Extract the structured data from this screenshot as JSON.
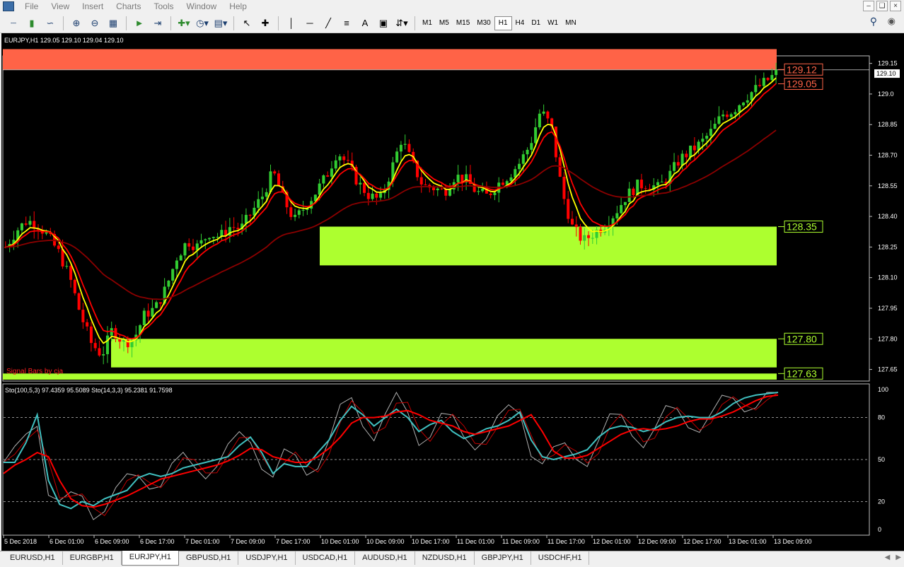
{
  "menu": [
    "File",
    "View",
    "Insert",
    "Charts",
    "Tools",
    "Window",
    "Help"
  ],
  "toolbar": {
    "icons": [
      "bar-chart-icon",
      "candlestick-icon",
      "line-chart-icon",
      "zoom-in-icon",
      "zoom-out-icon",
      "tile-windows-icon",
      "autoscroll-icon",
      "chart-shift-icon",
      "indicators-icon",
      "periods-icon",
      "templates-icon",
      "cursor-icon",
      "crosshair-icon",
      "vertical-line-icon",
      "horizontal-line-icon",
      "trendline-icon",
      "fibonacci-icon",
      "text-icon",
      "text-label-icon",
      "arrows-icon"
    ],
    "text_tool": "A",
    "timeframes": [
      "M1",
      "M5",
      "M15",
      "M30",
      "H1",
      "H4",
      "D1",
      "W1",
      "MN"
    ],
    "active_timeframe": "H1"
  },
  "chart": {
    "header": "EURJPY,H1  129.05 129.10 129.04 129.10",
    "signal_label": "Signal Bars by cja",
    "colors": {
      "bull": "#32cd32",
      "bear": "#ff0000",
      "zone": "#adff2f",
      "banner": "#ff6347",
      "ema_fast": "#ffff00",
      "ema_mid": "#ff0000",
      "ema_slow": "#8b0000"
    }
  },
  "price_axis": {
    "ticks": [
      "129.15",
      "129.0",
      "128.85",
      "128.70",
      "128.55",
      "128.40",
      "128.25",
      "128.10",
      "127.95",
      "127.80",
      "127.65"
    ],
    "current_price": "129.10"
  },
  "levels": [
    {
      "label": "129.12",
      "price": 129.12,
      "color": "#ff6347"
    },
    {
      "label": "129.05",
      "price": 129.05,
      "color": "#ff6347"
    },
    {
      "label": "128.35",
      "price": 128.35,
      "color": "#adff2f"
    },
    {
      "label": "127.80",
      "price": 127.8,
      "color": "#adff2f"
    },
    {
      "label": "127.63",
      "price": 127.63,
      "color": "#adff2f"
    }
  ],
  "zones": [
    {
      "top": 129.22,
      "bottom": 129.12,
      "color": "#ff6347"
    },
    {
      "top": 128.35,
      "bottom": 128.16,
      "color": "#adff2f"
    },
    {
      "top": 127.8,
      "bottom": 127.66,
      "color": "#adff2f"
    },
    {
      "top": 127.63,
      "bottom": 127.6,
      "color": "#adff2f"
    }
  ],
  "indicator": {
    "label": "Sto(100,5,3) 97.4359 95.5089  Sto(14,3,3) 95.2381 91.7598",
    "ticks": [
      "100",
      "80",
      "50",
      "20",
      "0"
    ],
    "levels": [
      80,
      50,
      20
    ],
    "colors": {
      "slow_main": "#40c0c0",
      "slow_signal": "#ff0000",
      "fast_main": "#b0b0b0",
      "fast_signal": "#c00000"
    }
  },
  "time_axis": [
    "5 Dec 2018",
    "6 Dec 01:00",
    "6 Dec 09:00",
    "6 Dec 17:00",
    "7 Dec 01:00",
    "7 Dec 09:00",
    "7 Dec 17:00",
    "10 Dec 01:00",
    "10 Dec 09:00",
    "10 Dec 17:00",
    "11 Dec 01:00",
    "11 Dec 09:00",
    "11 Dec 17:00",
    "12 Dec 01:00",
    "12 Dec 09:00",
    "12 Dec 17:00",
    "13 Dec 01:00",
    "13 Dec 09:00"
  ],
  "tabs": [
    "EURUSD,H1",
    "EURGBP,H1",
    "EURJPY,H1",
    "GBPUSD,H1",
    "USDJPY,H1",
    "USDCAD,H1",
    "AUDUSD,H1",
    "NZDUSD,H1",
    "GBPJPY,H1",
    "USDCHF,H1"
  ],
  "active_tab": "EURJPY,H1",
  "chart_data": {
    "type": "candlestick",
    "symbol": "EURJPY",
    "timeframe": "H1",
    "ylim": [
      127.6,
      129.18
    ],
    "price_anchors": [
      128.25,
      128.33,
      128.38,
      128.36,
      128.3,
      128.22,
      128.1,
      127.92,
      127.78,
      127.72,
      127.85,
      127.78,
      127.8,
      127.92,
      127.95,
      128.05,
      128.2,
      128.28,
      128.25,
      128.32,
      128.3,
      128.35,
      128.34,
      128.42,
      128.5,
      128.62,
      128.48,
      128.38,
      128.45,
      128.52,
      128.6,
      128.72,
      128.65,
      128.56,
      128.5,
      128.48,
      128.62,
      128.78,
      128.66,
      128.55,
      128.54,
      128.52,
      128.6,
      128.58,
      128.52,
      128.5,
      128.56,
      128.6,
      128.66,
      128.75,
      128.92,
      128.84,
      128.52,
      128.34,
      128.28,
      128.32,
      128.36,
      128.42,
      128.5,
      128.55,
      128.56,
      128.54,
      128.6,
      128.68,
      128.72,
      128.76,
      128.82,
      128.9,
      128.92,
      128.98,
      129.02,
      129.06,
      129.1
    ],
    "stoch_slow_main": [
      48,
      48,
      62,
      82,
      35,
      18,
      15,
      20,
      17,
      22,
      25,
      28,
      37,
      40,
      38,
      40,
      44,
      46,
      48,
      50,
      52,
      60,
      66,
      55,
      40,
      47,
      45,
      45,
      55,
      64,
      78,
      88,
      82,
      74,
      80,
      86,
      80,
      70,
      75,
      78,
      70,
      65,
      68,
      72,
      74,
      78,
      84,
      64,
      52,
      50,
      52,
      54,
      57,
      66,
      72,
      74,
      73,
      70,
      72,
      77,
      80,
      81,
      80,
      80,
      84,
      90,
      94,
      96,
      97,
      98
    ],
    "stoch_slow_signal": [
      40,
      46,
      50,
      55,
      52,
      35,
      22,
      17,
      16,
      18,
      21,
      24,
      28,
      32,
      36,
      38,
      40,
      42,
      44,
      46,
      49,
      53,
      58,
      57,
      52,
      50,
      48,
      48,
      52,
      58,
      66,
      76,
      80,
      80,
      81,
      84,
      85,
      82,
      78,
      76,
      74,
      70,
      68,
      70,
      72,
      74,
      78,
      82,
      70,
      56,
      51,
      51,
      53,
      58,
      63,
      68,
      71,
      72,
      71,
      72,
      74,
      77,
      79,
      79,
      81,
      84,
      88,
      92,
      95,
      96
    ]
  }
}
